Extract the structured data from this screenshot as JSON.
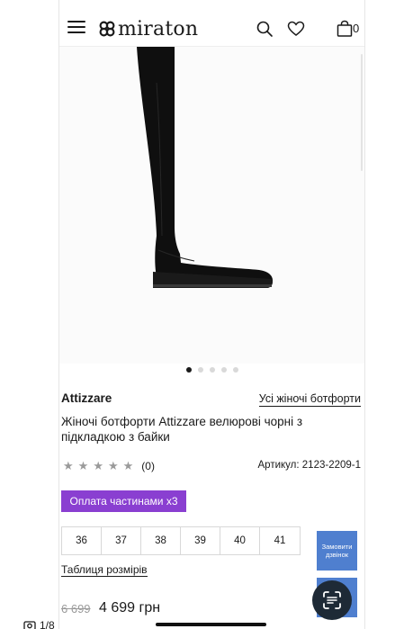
{
  "header": {
    "logo_text": "miraton",
    "cart_count": "0",
    "icons": [
      "menu-icon",
      "search-icon",
      "heart-icon",
      "bag-icon"
    ]
  },
  "gallery": {
    "slides_count": 5,
    "active_slide": 1
  },
  "product": {
    "brand": "Attizzare",
    "category_link": "Усі жіночі ботфорти",
    "title": "Жіночі ботфорти Attizzare велюрові чорні з підкладкою з байки",
    "rating_count": "(0)",
    "rating_stars": 0,
    "article": "Артикул: 2123-2209-1",
    "installment_label": "Оплата частинами x3",
    "sizes": [
      "36",
      "37",
      "38",
      "39",
      "40",
      "41"
    ],
    "size_table_label": "Таблиця розмірів",
    "old_price": "6 699",
    "new_price": "4 699 грн"
  },
  "callback": {
    "label": "Замовити дзвінок"
  },
  "viewer": {
    "page_indicator": "1/8"
  },
  "colors": {
    "accent_purple": "#8a3fd1",
    "callback_blue": "#4f7fcf",
    "fab_dark": "#1e2a36",
    "text": "#1a1a1a"
  }
}
